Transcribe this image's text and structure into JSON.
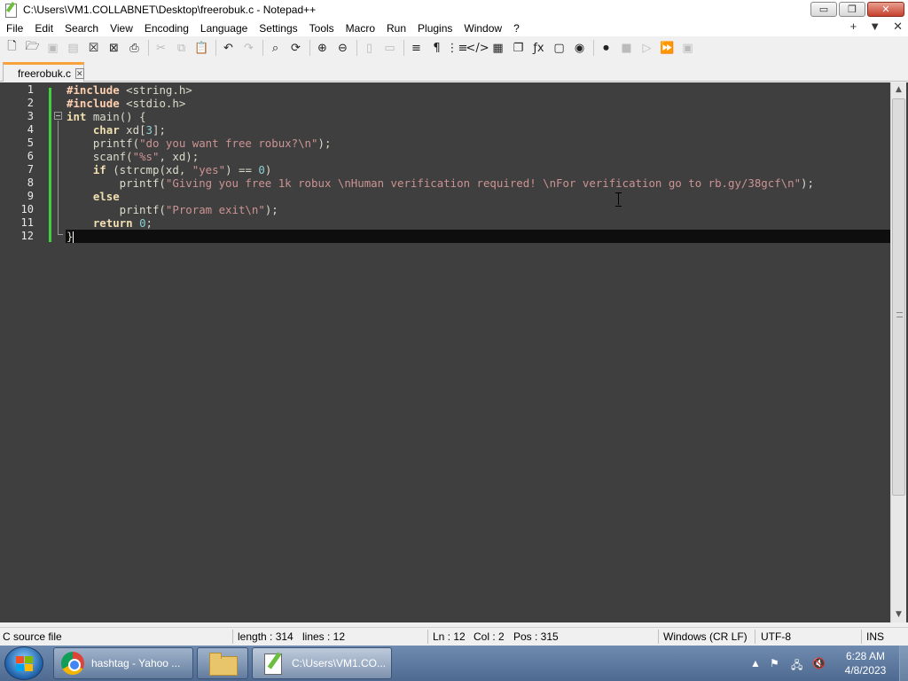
{
  "window": {
    "title": "C:\\Users\\VM1.COLLABNET\\Desktop\\freerobuk.c - Notepad++",
    "min_label": "▭",
    "max_label": "❐",
    "close_label": "✕"
  },
  "menu": {
    "items": [
      "File",
      "Edit",
      "Search",
      "View",
      "Encoding",
      "Language",
      "Settings",
      "Tools",
      "Macro",
      "Run",
      "Plugins",
      "Window",
      "?"
    ],
    "right": [
      "+",
      "▼",
      "✕"
    ]
  },
  "toolbar": {
    "icons": [
      "new-file-icon",
      "open-file-icon",
      "save-icon",
      "save-all-icon",
      "close-icon",
      "close-all-icon",
      "print-icon",
      "cut-icon",
      "copy-icon",
      "paste-icon",
      "undo-icon",
      "redo-icon",
      "find-icon",
      "replace-icon",
      "zoom-in-icon",
      "zoom-out-icon",
      "sync-v-icon",
      "sync-h-icon",
      "word-wrap-icon",
      "show-all-chars-icon",
      "indent-guide-icon",
      "udl-icon",
      "doc-map-icon",
      "doc-list-icon",
      "function-list-icon",
      "folder-workspace-icon",
      "monitoring-icon",
      "record-macro-icon",
      "stop-macro-icon",
      "play-macro-icon",
      "run-macro-multiple-icon",
      "save-macro-icon"
    ]
  },
  "tab": {
    "label": "freerobuk.c",
    "close": "✕"
  },
  "editor": {
    "line_numbers": [
      "1",
      "2",
      "3",
      "4",
      "5",
      "6",
      "7",
      "8",
      "9",
      "10",
      "11",
      "12"
    ],
    "lines": [
      [
        {
          "t": "#include ",
          "c": "pp"
        },
        {
          "t": "<string.h>",
          "c": ""
        }
      ],
      [
        {
          "t": "#include ",
          "c": "pp"
        },
        {
          "t": "<stdio.h>",
          "c": ""
        }
      ],
      [
        {
          "t": "int",
          "c": "kw"
        },
        {
          "t": " main() {",
          "c": ""
        }
      ],
      [
        {
          "t": "    ",
          "c": ""
        },
        {
          "t": "char",
          "c": "kw"
        },
        {
          "t": " xd[",
          "c": ""
        },
        {
          "t": "3",
          "c": "num"
        },
        {
          "t": "];",
          "c": ""
        }
      ],
      [
        {
          "t": "    printf(",
          "c": ""
        },
        {
          "t": "\"do you want free robux?\\n\"",
          "c": "st"
        },
        {
          "t": ");",
          "c": ""
        }
      ],
      [
        {
          "t": "    scanf(",
          "c": ""
        },
        {
          "t": "\"%s\"",
          "c": "st"
        },
        {
          "t": ", xd);",
          "c": ""
        }
      ],
      [
        {
          "t": "    ",
          "c": ""
        },
        {
          "t": "if",
          "c": "kw"
        },
        {
          "t": " (strcmp(xd, ",
          "c": ""
        },
        {
          "t": "\"yes\"",
          "c": "st"
        },
        {
          "t": ") == ",
          "c": ""
        },
        {
          "t": "0",
          "c": "num"
        },
        {
          "t": ")",
          "c": ""
        }
      ],
      [
        {
          "t": "        printf(",
          "c": ""
        },
        {
          "t": "\"Giving you free 1k robux \\nHuman verification required! \\nFor verification go to rb.gy/38gcf\\n\"",
          "c": "st"
        },
        {
          "t": ");",
          "c": ""
        }
      ],
      [
        {
          "t": "    ",
          "c": ""
        },
        {
          "t": "else",
          "c": "kw"
        }
      ],
      [
        {
          "t": "        printf(",
          "c": ""
        },
        {
          "t": "\"Proram exit\\n\"",
          "c": "st"
        },
        {
          "t": ");",
          "c": ""
        }
      ],
      [
        {
          "t": "    ",
          "c": ""
        },
        {
          "t": "return",
          "c": "kw"
        },
        {
          "t": " ",
          "c": ""
        },
        {
          "t": "0",
          "c": "num"
        },
        {
          "t": ";",
          "c": ""
        }
      ],
      [
        {
          "t": "}",
          "c": ""
        }
      ]
    ]
  },
  "status": {
    "type": "C source file",
    "length": "length : 314",
    "lines": "lines : 12",
    "ln": "Ln : 12",
    "col": "Col : 2",
    "pos": "Pos : 315",
    "eol": "Windows (CR LF)",
    "encoding": "UTF-8",
    "mode": "INS"
  },
  "taskbar": {
    "chrome_label": "hashtag - Yahoo ...",
    "npp_label": "C:\\Users\\VM1.CO...",
    "time": "6:28 AM",
    "date": "4/8/2023",
    "tray_arrow": "▲"
  },
  "colors": {
    "editor_bg": "#3f3f3f",
    "current_line": "#0e0e0e",
    "keyword": "#f0dfaf",
    "string": "#cc9393",
    "number": "#8cd0d3",
    "change_bar": "#3fcf3f",
    "tab_accent": "#f7a23a"
  }
}
